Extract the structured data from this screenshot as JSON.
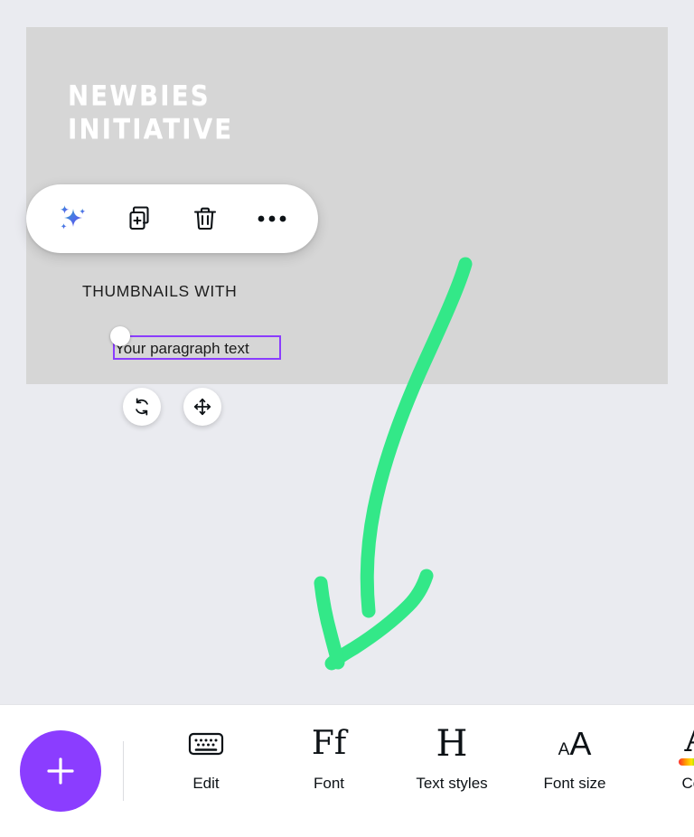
{
  "canvas": {
    "heading_lines": [
      "NEWBIES",
      "INITIATIVE"
    ],
    "heading_full": "NEWBIES INITIATIVE",
    "subheading": "THUMBNAILS WITH",
    "selected_text": "Your paragraph text",
    "background_color": "#d6d6d6",
    "selection_color": "#8b3dff"
  },
  "workspace": {
    "background_color": "#eaebf0"
  },
  "object_toolbar": {
    "items": [
      {
        "name": "magic-sparkles",
        "label": "Magic"
      },
      {
        "name": "duplicate",
        "label": "Duplicate"
      },
      {
        "name": "delete",
        "label": "Delete"
      },
      {
        "name": "more",
        "label": "More"
      }
    ]
  },
  "transform_handles": [
    {
      "name": "rotate",
      "label": "Rotate"
    },
    {
      "name": "move",
      "label": "Move"
    }
  ],
  "annotation": {
    "type": "freehand-arrow",
    "color": "#33e888",
    "direction": "down-left",
    "stroke_width": 15
  },
  "bottom_bar": {
    "add_button": {
      "label": "+",
      "color": "#8b3dff"
    },
    "items": [
      {
        "icon": "keyboard-icon",
        "label": "Edit"
      },
      {
        "icon": "font-icon",
        "label": "Font"
      },
      {
        "icon": "text-styles-icon",
        "label": "Text styles"
      },
      {
        "icon": "font-size-icon",
        "label": "Font size"
      },
      {
        "icon": "color-icon",
        "label": "Colo"
      }
    ],
    "glyphs": {
      "font": "Ff",
      "text_styles": "H",
      "font_size_small": "A",
      "font_size_big": "A",
      "color_letter": "A"
    }
  }
}
